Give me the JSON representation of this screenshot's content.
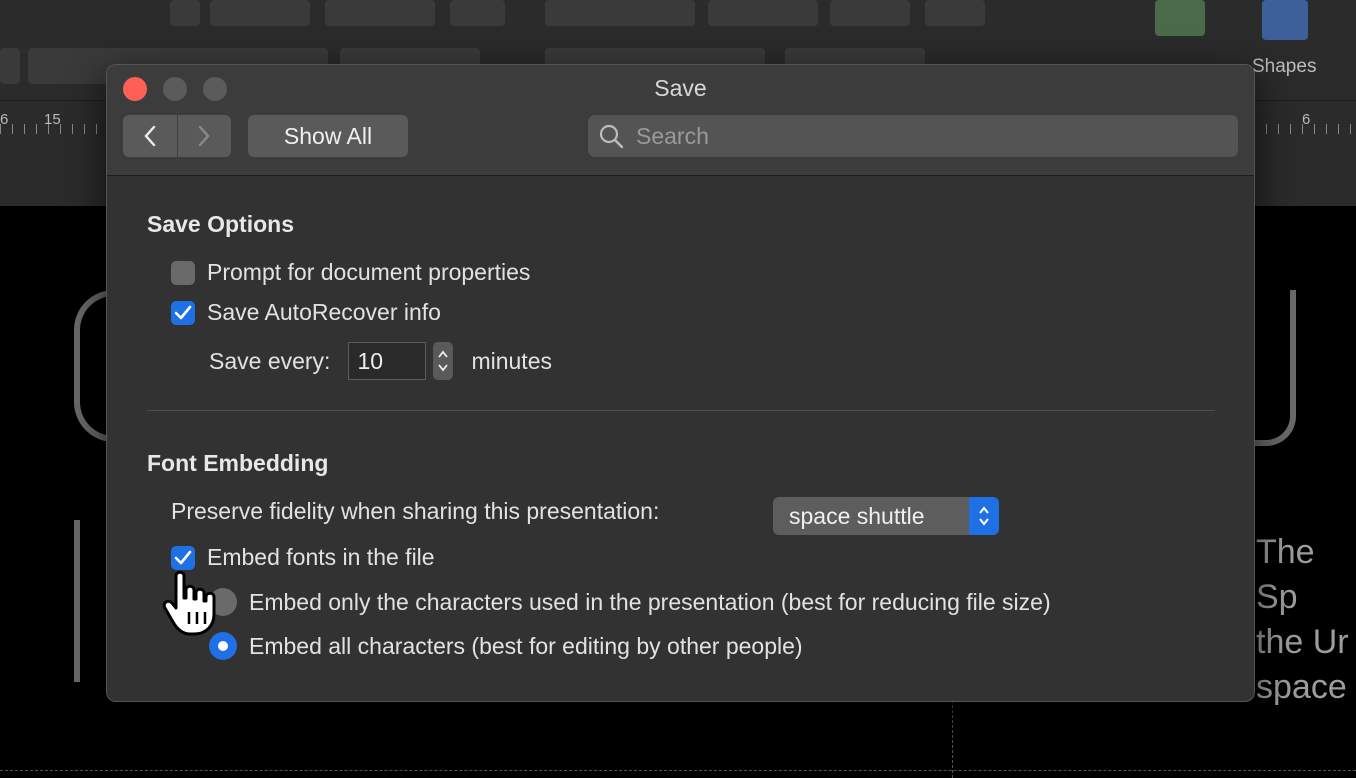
{
  "background": {
    "ruler_numbers": [
      "6",
      "15",
      "6"
    ],
    "right_label": "Shapes",
    "slide_text_lines": [
      "The Sp",
      "the Ur",
      "space"
    ]
  },
  "dialog": {
    "title": "Save",
    "nav": {
      "back_icon": "chevron-left-icon",
      "forward_icon": "chevron-right-icon"
    },
    "show_all_label": "Show All",
    "search": {
      "placeholder": "Search",
      "value": ""
    },
    "save_options": {
      "heading": "Save Options",
      "prompt_props": {
        "label": "Prompt for document properties",
        "checked": false
      },
      "autorecover": {
        "label": "Save AutoRecover info",
        "checked": true
      },
      "save_every": {
        "label": "Save every:",
        "value": "10",
        "unit": "minutes"
      }
    },
    "font_embedding": {
      "heading": "Font Embedding",
      "preserve_label": "Preserve fidelity when sharing this presentation:",
      "presentation_select": "space shuttle",
      "embed_fonts": {
        "label": "Embed fonts in the file",
        "checked": true
      },
      "embed_only_used": {
        "label": "Embed only the characters used in the presentation (best for reducing file size)",
        "selected": false
      },
      "embed_all": {
        "label": "Embed all characters (best for editing by other people)",
        "selected": true
      }
    }
  },
  "colors": {
    "accent": "#1f6fe5",
    "close": "#fe5f57"
  }
}
